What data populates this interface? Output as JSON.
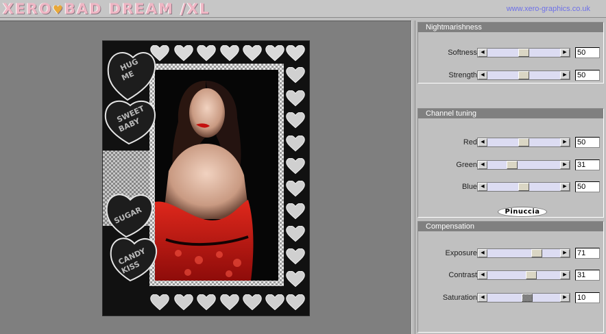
{
  "header": {
    "title_part1": "XERO",
    "title_part2": "BAD DREAM /XL",
    "site_link": "www.xero-graphics.co.uk"
  },
  "preview": {
    "frame_words": [
      "HUG",
      "ME",
      "SWEET",
      "BABY",
      "SUGAR",
      "CANDY",
      "KISS"
    ]
  },
  "panels": {
    "nightmarishness": {
      "title": "Nightmarishness",
      "sliders": [
        {
          "label": "Softness",
          "value": "50",
          "fraction": 0.5
        },
        {
          "label": "Strength",
          "value": "50",
          "fraction": 0.5
        }
      ]
    },
    "channel_tuning": {
      "title": "Channel tuning",
      "sliders": [
        {
          "label": "Red",
          "value": "50",
          "fraction": 0.5
        },
        {
          "label": "Green",
          "value": "31",
          "fraction": 0.31
        },
        {
          "label": "Blue",
          "value": "50",
          "fraction": 0.5
        }
      ],
      "badge": "Pinuccia"
    },
    "compensation": {
      "title": "Compensation",
      "sliders": [
        {
          "label": "Exposure",
          "value": "71",
          "fraction": 0.71
        },
        {
          "label": "Contrast",
          "value": "31",
          "fraction": 0.62
        },
        {
          "label": "Saturation",
          "value": "10",
          "fraction": 0.55
        }
      ]
    }
  },
  "colors": {
    "title_pink": "#efb6c4",
    "title_heart": "#e8a83a",
    "link_blue": "#6d70e8",
    "panel_header": "#808080",
    "slider_track": "#dcdcf2",
    "preview_bg": "#7f7f7f"
  },
  "icons": {
    "left_arrow": "◀",
    "right_arrow": "▶",
    "title_heart": "♥"
  }
}
